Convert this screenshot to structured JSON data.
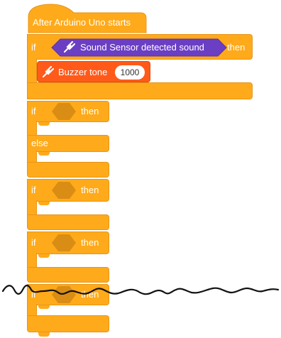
{
  "hat_block": {
    "label": "After Arduino Uno starts"
  },
  "if_then_block_1": {
    "if_label": "if",
    "then_label": "then",
    "condition": {
      "label": "Sound Sensor detected sound",
      "icon": "plug-icon",
      "color": "#6b3fc4"
    },
    "body_block": {
      "label": "Buzzer tone",
      "value": "1000",
      "icon": "plug-icon",
      "color": "#ff5a1a"
    }
  },
  "if_else_block": {
    "if_label": "if",
    "then_label": "then",
    "else_label": "else"
  },
  "if_block_3": {
    "if_label": "if",
    "then_label": "then"
  },
  "if_block_4": {
    "if_label": "if",
    "then_label": "then"
  },
  "if_block_5": {
    "if_label": "if",
    "then_label": "then"
  },
  "colors": {
    "control": "#ffaa1a",
    "control_dark": "#e8951a",
    "sensor": "#6b3fc4",
    "output": "#ff5a1a",
    "hex_slot": "#d98d14"
  }
}
